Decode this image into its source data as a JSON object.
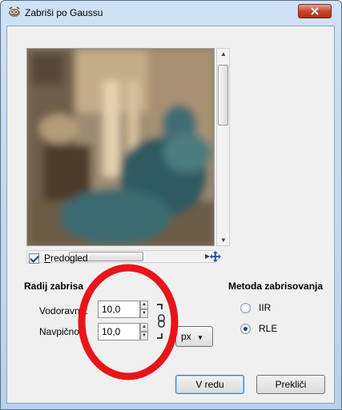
{
  "window": {
    "title": "Zabriši po Gaussu",
    "close_icon": "close-x-icon"
  },
  "preview": {
    "checkbox_label": "Predogled",
    "checkbox_mnemonic": "P",
    "checkbox_rest": "redogled",
    "checked": true
  },
  "radius": {
    "title": "Radij zabrisa",
    "horizontal_label": "Vodoravno:",
    "vertical_label": "Navpično:",
    "horizontal_value": "10,0",
    "vertical_value": "10,0",
    "unit": "px"
  },
  "method": {
    "title": "Metoda zabrisovanja",
    "options": [
      {
        "label": "IIR",
        "checked": false
      },
      {
        "label": "RLE",
        "checked": true
      }
    ]
  },
  "buttons": {
    "ok": "V redu",
    "cancel": "Prekliči"
  },
  "colors": {
    "annotation_circle": "#e8141a",
    "close_button": "#c9462c"
  }
}
